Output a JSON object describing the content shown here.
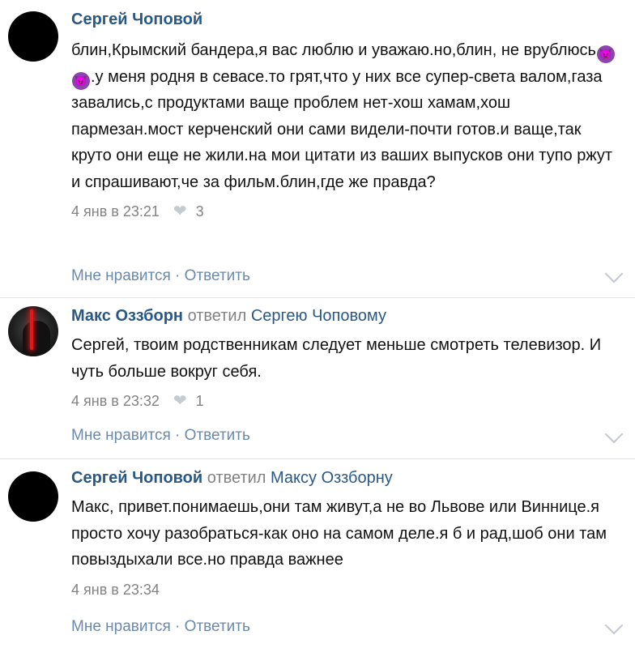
{
  "comments": [
    {
      "author": "Сергей Чоповой",
      "replied_label": "",
      "reply_to": "",
      "text_before_emoji": "блин,Крымский бандера,я вас люблю и уважаю.но,блин, не врублюсь",
      "emoji": "smiling-imp-icon",
      "text_after_emoji": ".у меня родня в севасе.то грят,что у них все супер-света валом,газа завались,с продуктами ваще проблем нет-хош хамам,хош пармезан.мост керченский они сами видели-почти готов.и ваще,так круто они еще не жили.на мои цитати из ваших выпусков они тупо ржут и спрашивают,че за фильм.блин,где же правда?",
      "time": "4 янв в 23:21",
      "likes": "3",
      "actions": "Мне нравится · Ответить"
    },
    {
      "author": "Макс Оззборн",
      "replied_label": "ответил",
      "reply_to": "Сергею Чоповому",
      "text": "Сергей, твоим родственникам следует меньше смотреть телевизор. И чуть больше вокруг себя.",
      "time": "4 янв в 23:32",
      "likes": "1",
      "actions": "Мне нравится · Ответить"
    },
    {
      "author": "Сергей Чоповой",
      "replied_label": "ответил",
      "reply_to": "Максу Оззборну",
      "text": "Макс, привет.понимаешь,они там живут,а не во Львове или Виннице.я просто хочу разобраться-как оно на самом деле.я б и рад,шоб они там повыздыхали все.но правда важнее",
      "time": "4 янв в 23:34",
      "actions": "Мне нравится · Ответить"
    }
  ],
  "colors": {
    "author": "#2a5885",
    "meta": "#828282",
    "actions": "#6a89ad"
  }
}
